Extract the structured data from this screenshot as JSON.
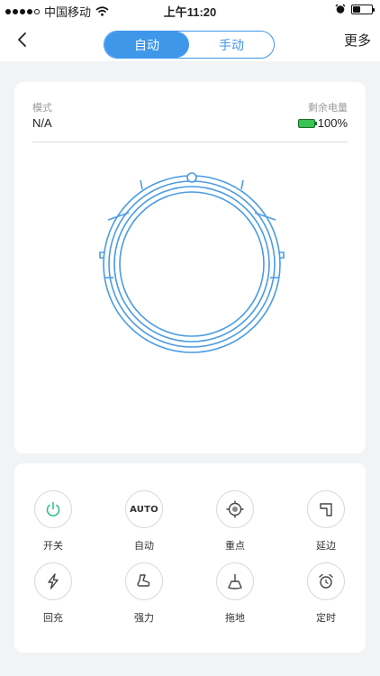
{
  "status_bar": {
    "carrier": "中国移动",
    "time": "上午11:20",
    "icons": [
      "signal-dots-icon",
      "wifi-icon",
      "alarm-icon",
      "battery-icon"
    ]
  },
  "nav": {
    "back_icon": "chevron-left-icon",
    "tabs": [
      {
        "label": "自动",
        "active": true
      },
      {
        "label": "手动",
        "active": false
      }
    ],
    "more_label": "更多",
    "accent_color": "#3f97ea"
  },
  "status": {
    "mode_label": "模式",
    "mode_value": "N/A",
    "battery_label": "剩余电量",
    "battery_value": "100%",
    "battery_level": 1.0,
    "battery_color": "#39c353"
  },
  "robot": {
    "icon": "robot-vacuum-outline-icon",
    "color": "#4a9be4"
  },
  "controls": [
    {
      "label": "开关",
      "icon": "power-icon"
    },
    {
      "label": "自动",
      "icon": "auto-icon",
      "text": "AUTO"
    },
    {
      "label": "重点",
      "icon": "target-icon"
    },
    {
      "label": "延边",
      "icon": "edge-icon"
    },
    {
      "label": "回充",
      "icon": "recharge-icon"
    },
    {
      "label": "强力",
      "icon": "power-suction-icon"
    },
    {
      "label": "拖地",
      "icon": "mop-icon"
    },
    {
      "label": "定时",
      "icon": "alarm-clock-icon"
    }
  ]
}
